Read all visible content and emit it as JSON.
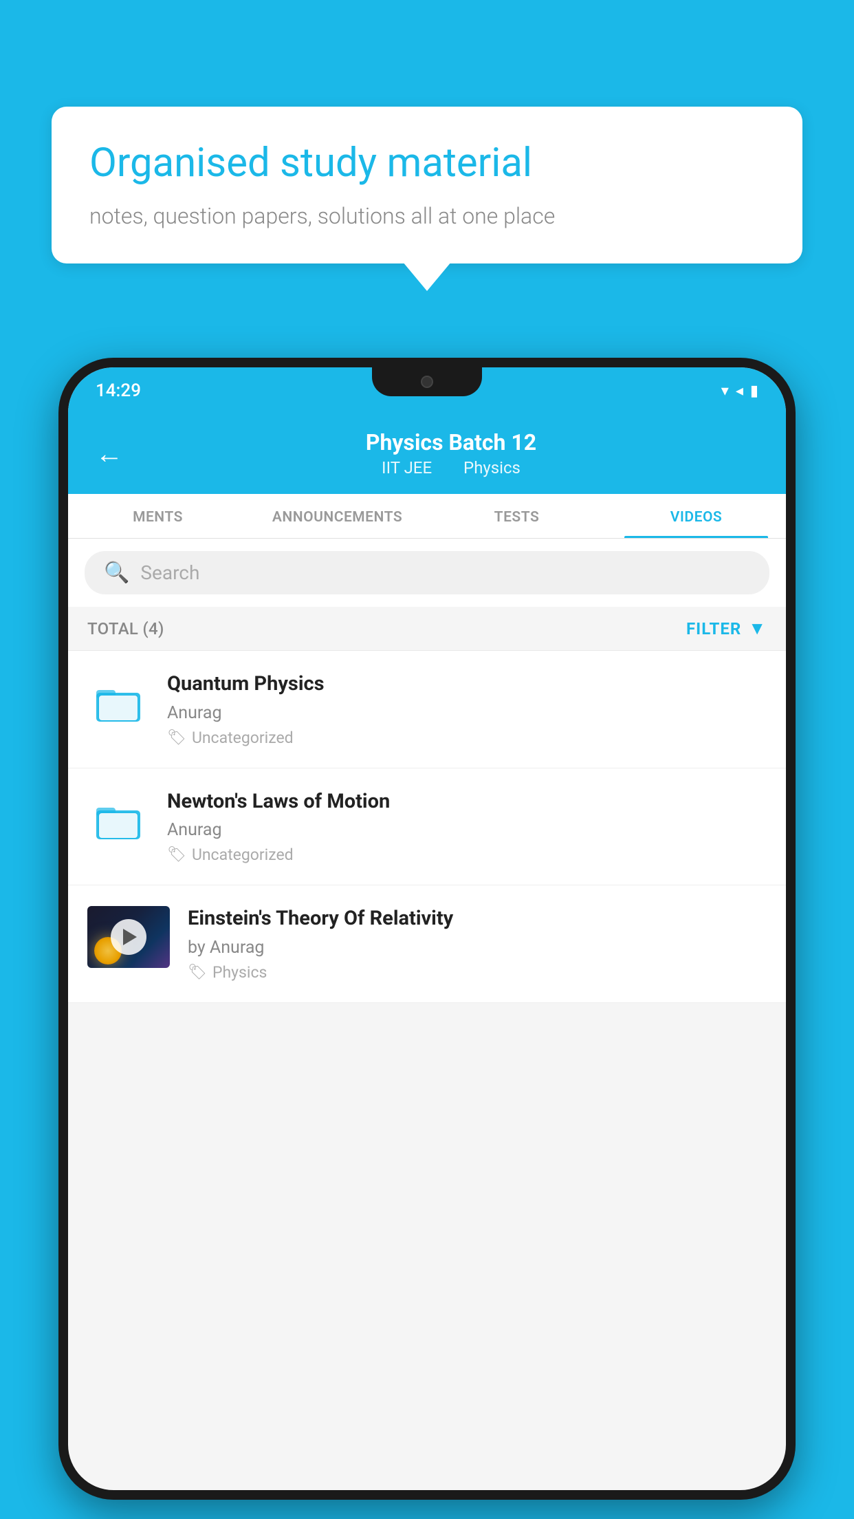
{
  "background_color": "#1bb8e8",
  "speech_bubble": {
    "title": "Organised study material",
    "subtitle": "notes, question papers, solutions all at one place"
  },
  "status_bar": {
    "time": "14:29",
    "icons": [
      "wifi",
      "signal",
      "battery"
    ]
  },
  "app_header": {
    "back_label": "←",
    "title": "Physics Batch 12",
    "subtitle_part1": "IIT JEE",
    "subtitle_part2": "Physics"
  },
  "tabs": [
    {
      "label": "MENTS",
      "active": false
    },
    {
      "label": "ANNOUNCEMENTS",
      "active": false
    },
    {
      "label": "TESTS",
      "active": false
    },
    {
      "label": "VIDEOS",
      "active": true
    }
  ],
  "search": {
    "placeholder": "Search"
  },
  "filter_bar": {
    "total_label": "TOTAL (4)",
    "filter_label": "FILTER"
  },
  "videos": [
    {
      "id": 1,
      "title": "Quantum Physics",
      "author": "Anurag",
      "tag": "Uncategorized",
      "has_thumbnail": false
    },
    {
      "id": 2,
      "title": "Newton's Laws of Motion",
      "author": "Anurag",
      "tag": "Uncategorized",
      "has_thumbnail": false
    },
    {
      "id": 3,
      "title": "Einstein's Theory Of Relativity",
      "author": "by Anurag",
      "tag": "Physics",
      "has_thumbnail": true
    }
  ]
}
